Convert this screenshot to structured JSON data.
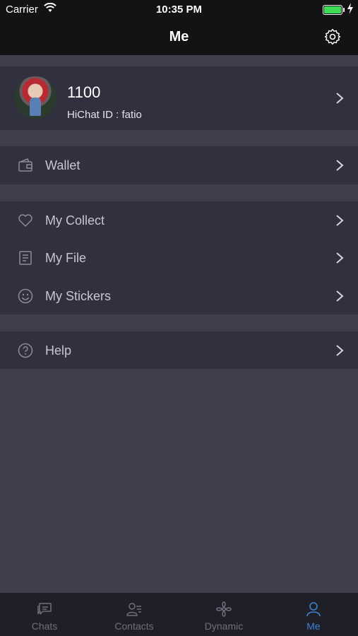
{
  "status_bar": {
    "carrier": "Carrier",
    "time": "10:35 PM",
    "battery_level": 1.0
  },
  "navbar": {
    "title": "Me",
    "settings_icon": "gear-icon"
  },
  "profile": {
    "name": "1100",
    "hichat_id": "HiChat ID : fatio"
  },
  "menu": {
    "wallet": "Wallet",
    "my_collect": "My Collect",
    "my_file": "My File",
    "my_stickers": "My Stickers",
    "help": "Help"
  },
  "tabs": [
    {
      "label": "Chats",
      "icon": "chat-icon",
      "active": false
    },
    {
      "label": "Contacts",
      "icon": "contacts-icon",
      "active": false
    },
    {
      "label": "Dynamic",
      "icon": "flower-icon",
      "active": false
    },
    {
      "label": "Me",
      "icon": "person-icon",
      "active": true
    }
  ],
  "colors": {
    "bar_background": "#131316",
    "group_background": "#30303e",
    "page_background": "#3e3e4d",
    "active_tab": "#3b82d4",
    "inactive_tab": "#6e6e7e"
  }
}
